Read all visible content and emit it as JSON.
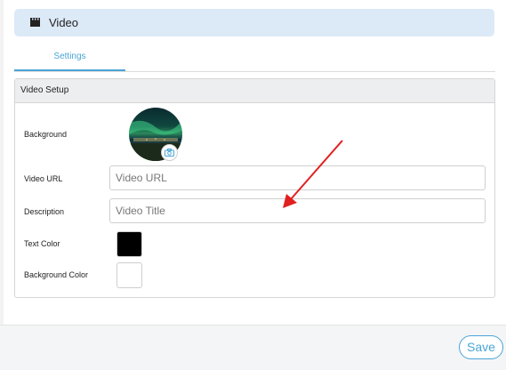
{
  "header": {
    "title": "Video",
    "icon": "clapperboard-icon"
  },
  "tabs": [
    {
      "label": "Settings",
      "active": true
    }
  ],
  "section": {
    "title": "Video Setup",
    "fields": {
      "background": {
        "label": "Background"
      },
      "video_url": {
        "label": "Video URL",
        "placeholder": "Video URL",
        "value": ""
      },
      "description": {
        "label": "Description",
        "placeholder": "Video Title",
        "value": ""
      },
      "text_color": {
        "label": "Text Color",
        "value": "#000000"
      },
      "background_color": {
        "label": "Background Color",
        "value": "#ffffff"
      }
    }
  },
  "footer": {
    "save_label": "Save"
  },
  "colors": {
    "accent": "#4aa5d6",
    "header_bg": "#dce9f7",
    "annotation_arrow": "#e02020"
  }
}
